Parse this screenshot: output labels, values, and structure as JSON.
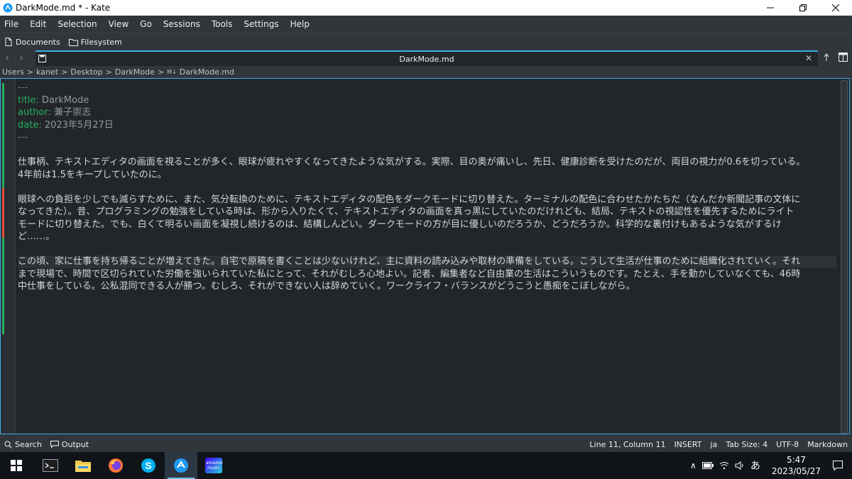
{
  "window": {
    "title": "DarkMode.md * - Kate",
    "app_icon": "kate-icon"
  },
  "menu": [
    "File",
    "Edit",
    "Selection",
    "View",
    "Go",
    "Sessions",
    "Tools",
    "Settings",
    "Help"
  ],
  "toolbar": {
    "documents": "Documents",
    "filesystem": "Filesystem"
  },
  "tab": {
    "label": "DarkMode.md"
  },
  "breadcrumb": [
    "Users",
    "kanet",
    "Desktop",
    "DarkMode",
    "DarkMode.md"
  ],
  "breadcrumb_badge": "M↓",
  "editor": {
    "lines": [
      {
        "type": "fm",
        "text": "---"
      },
      {
        "type": "kv",
        "key": "title:",
        "val": " DarkMode"
      },
      {
        "type": "kv",
        "key": "author:",
        "val": " 兼子崇志"
      },
      {
        "type": "kv",
        "key": "date:",
        "val": " 2023年5月27日"
      },
      {
        "type": "fm",
        "text": "---"
      },
      {
        "type": "blank",
        "text": ""
      },
      {
        "type": "p",
        "text": "仕事柄、テキストエディタの画面を視ることが多く、眼球が疲れやすくなってきたような気がする。実際、目の奥が痛いし、先日、健康診断を受けたのだが、両目の視力が0.6を切っている。"
      },
      {
        "type": "p",
        "text": "4年前は1.5をキープしていたのに。"
      },
      {
        "type": "blank",
        "text": ""
      },
      {
        "type": "p",
        "text": "眼球への負担を少しでも減らすために、また、気分転換のために、テキストエディタの配色をダークモードに切り替えた。ターミナルの配色に合わせたかたちだ（なんだか新聞記事の文体に"
      },
      {
        "type": "p",
        "text": "なってきた）。昔、プログラミングの勉強をしている時は、形から入りたくて、テキストエディタの画面を真っ黒にしていたのだけれども、結局、テキストの視認性を優先するためにライト"
      },
      {
        "type": "p",
        "text": "モードに切り替えた。でも、白くて明るい画面を凝視し続けるのは、結構しんどい。ダークモードの方が目に優しいのだろうか、どうだろうか。科学的な裏付けもあるような気がするけ"
      },
      {
        "type": "p",
        "text": "ど……。"
      },
      {
        "type": "blank",
        "text": ""
      },
      {
        "type": "hl",
        "text": "この頃、家に仕事を持ち帰ることが増えてきた。自宅で原稿を書くことは少ないけれど、主に資料の読み込みや取材の準備をしている。こうして生活が仕事のために組織化されていく。それ"
      },
      {
        "type": "p",
        "text": "まで現場で、時間で区切られていた労働を強いられていた私にとって、それがむしろ心地よい。記者、編集者など自由業の生活はこういうものです。たとえ、手を動かしていなくても、46時"
      },
      {
        "type": "p",
        "text": "中仕事をしている。公私混同できる人が勝つ。むしろ、それができない人は辞めていく。ワークライフ・バランスがどうこうと愚痴をこぼしながら。"
      }
    ]
  },
  "status": {
    "search": "Search",
    "output": "Output",
    "position": "Line 11, Column 11",
    "mode": "INSERT",
    "lang": "ja",
    "tab_size": "Tab Size: 4",
    "encoding": "UTF-8",
    "syntax": "Markdown"
  },
  "taskbar": {
    "apps": [
      "start-icon",
      "terminal-icon",
      "file-explorer-icon",
      "firefox-icon",
      "skype-icon",
      "kate-icon",
      "amazon-music-icon"
    ],
    "amazon_label": "amazon music",
    "ime": "あ",
    "time": "5:47",
    "date": "2023/05/27"
  },
  "colors": {
    "accent": "#3daee9",
    "window_bg": "#31363b",
    "editor_bg": "#232629",
    "frontmatter_key": "#27ae60",
    "modified_marker": "#e74c3c",
    "saved_marker": "#27ae60"
  }
}
